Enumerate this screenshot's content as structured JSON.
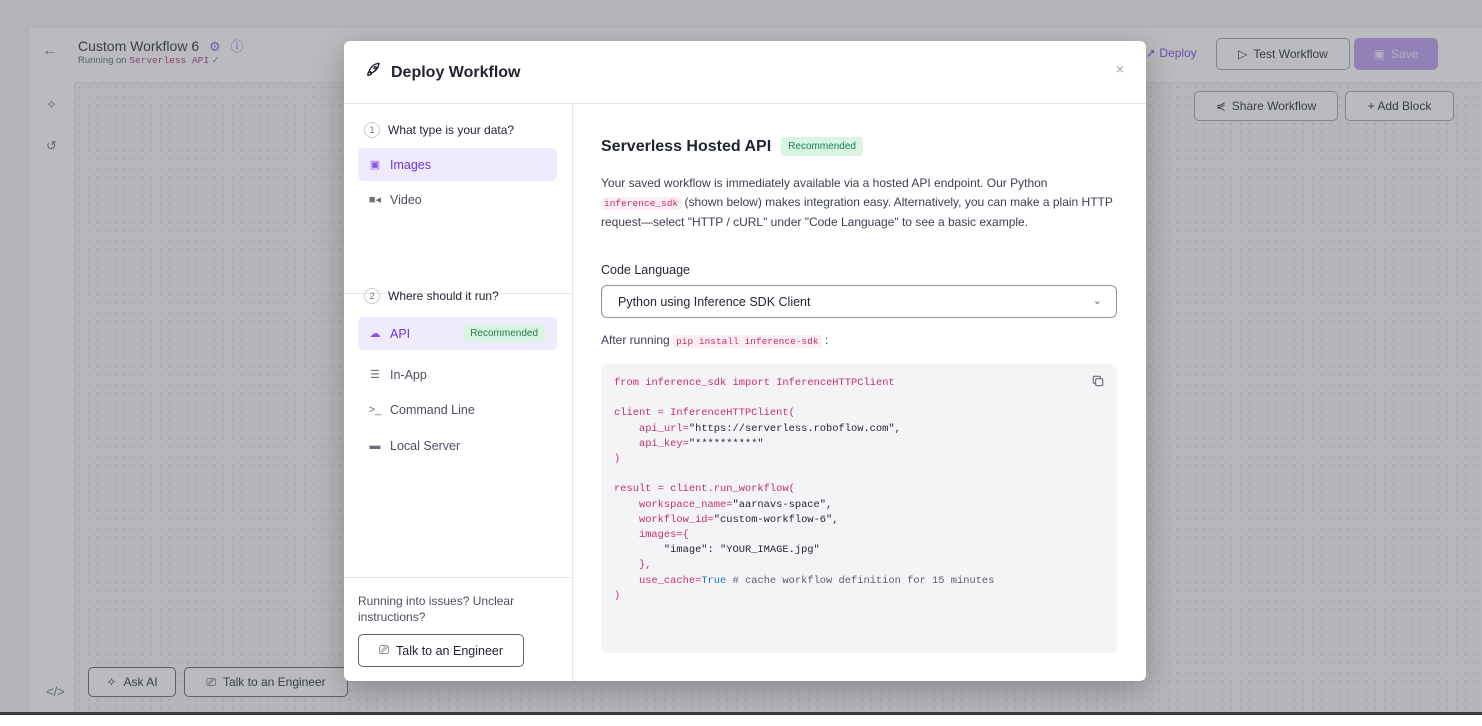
{
  "header": {
    "workflow_title": "Custom Workflow 6",
    "running_prefix": "Running on",
    "running_target": "Serverless API",
    "deploy_label": "Deploy",
    "test_label": "Test Workflow",
    "save_label": "Save"
  },
  "canvas_toolbar": {
    "share_label": "Share Workflow",
    "add_block_label": "+ Add Block"
  },
  "footer": {
    "ask_ai_label": "Ask AI",
    "talk_label": "Talk to an Engineer"
  },
  "modal": {
    "title": "Deploy Workflow",
    "close": "×",
    "step1": {
      "num": "1",
      "title": "What type is your data?",
      "options": [
        {
          "label": "Images",
          "icon": "image-icon"
        },
        {
          "label": "Video",
          "icon": "video-icon"
        }
      ]
    },
    "step2": {
      "num": "2",
      "title": "Where should it run?",
      "options": [
        {
          "label": "API",
          "icon": "cloud-icon",
          "badge": "Recommended"
        },
        {
          "label": "In-App",
          "icon": "app-icon"
        },
        {
          "label": "Command Line",
          "icon": "terminal-icon"
        },
        {
          "label": "Local Server",
          "icon": "laptop-icon"
        }
      ]
    },
    "help_text": "Running into issues? Unclear instructions?",
    "talk_label": "Talk to an Engineer",
    "section_title": "Serverless Hosted API",
    "section_badge": "Recommended",
    "desc_1": "Your saved workflow is immediately available via a hosted API endpoint. Our Python",
    "desc_code": "inference_sdk",
    "desc_2": "(shown below) makes integration easy. Alternatively, you can make a plain HTTP request—select \"HTTP / cURL\" under \"Code Language\" to see a basic example.",
    "code_language_label": "Code Language",
    "code_language_value": "Python using Inference SDK Client",
    "after_running_prefix": "After running",
    "after_running_code": "pip install inference-sdk",
    "after_running_suffix": ":",
    "code": {
      "import_from": "from",
      "import_module": "inference_sdk",
      "import_kw": "import",
      "import_name": "InferenceHTTPClient",
      "client_line": "client = InferenceHTTPClient(",
      "api_url_key": "api_url=",
      "api_url_val": "\"https://serverless.roboflow.com\",",
      "api_key_key": "api_key=",
      "api_key_val": "\"**********\"",
      "close_paren": ")",
      "result_line": "result = client.run_workflow(",
      "ws_key": "workspace_name=",
      "ws_val": "\"aarnavs-space\",",
      "wf_key": "workflow_id=",
      "wf_val": "\"custom-workflow-6\",",
      "images_key": "images={",
      "image_entry": "\"image\": \"YOUR_IMAGE.jpg\"",
      "images_close": "},",
      "cache_key": "use_cache=",
      "cache_val": "True",
      "cache_comment": "# cache workflow definition for 15 minutes"
    }
  }
}
